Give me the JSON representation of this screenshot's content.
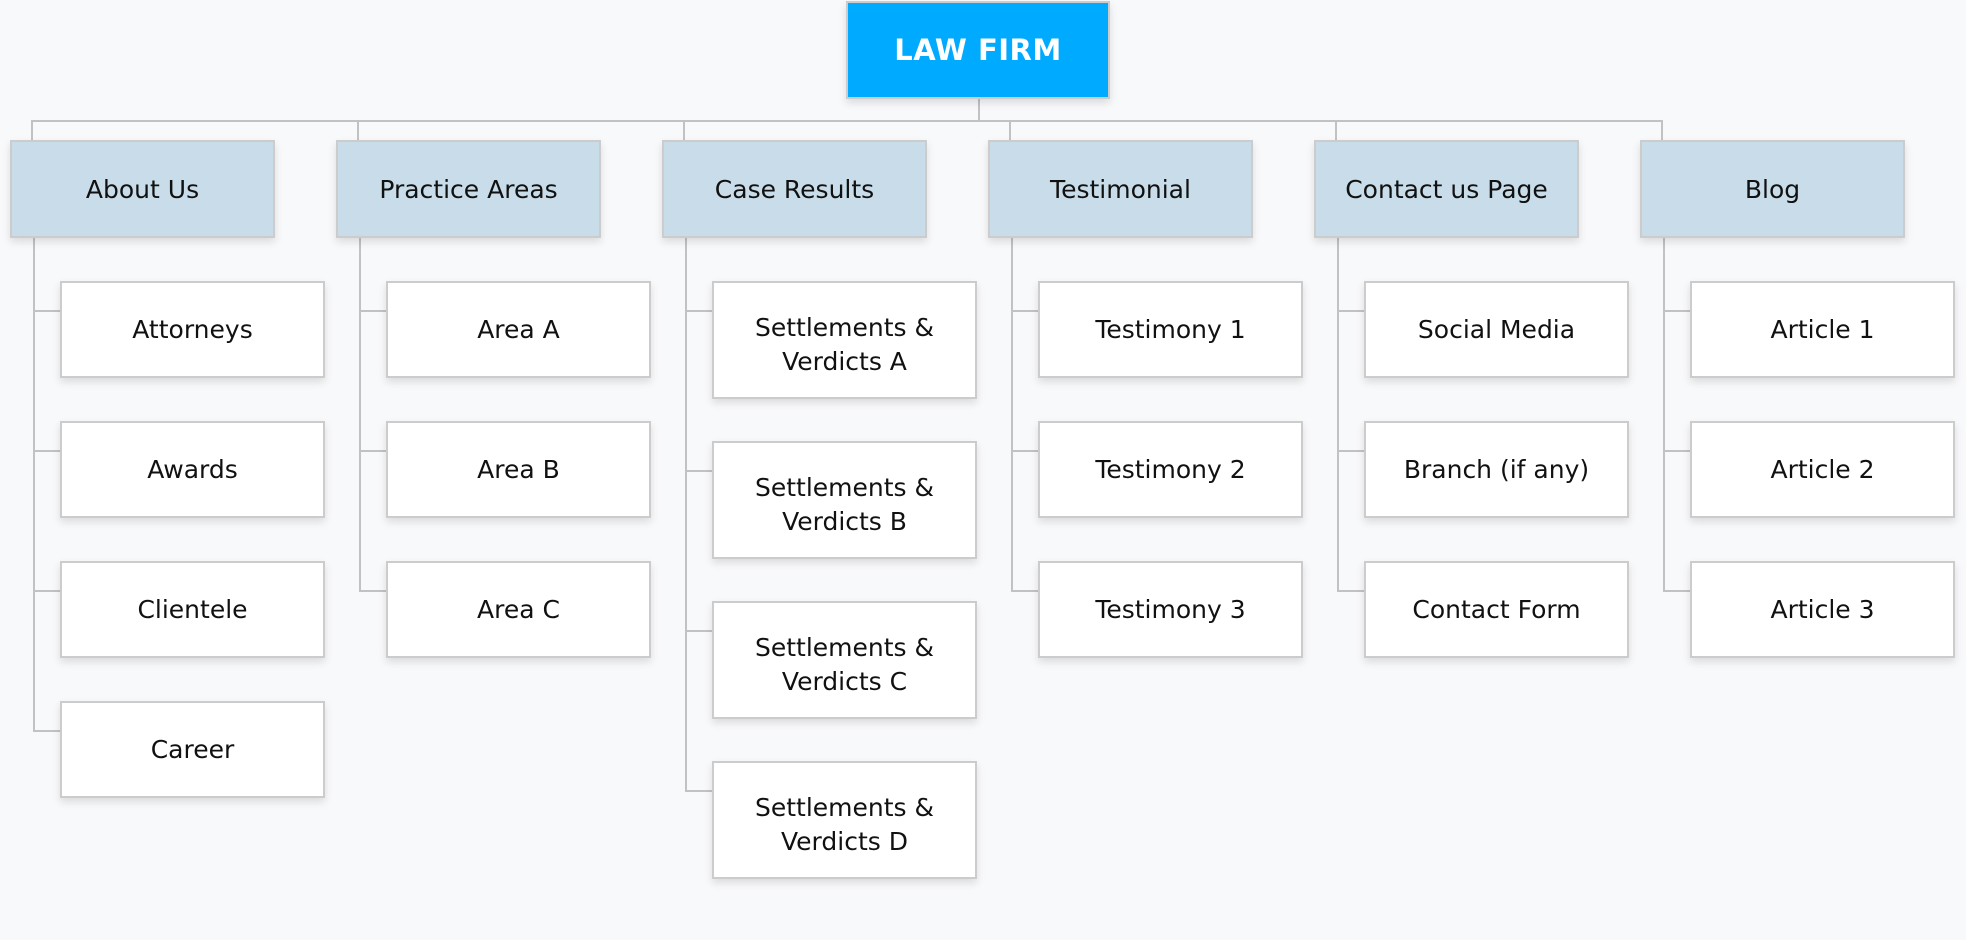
{
  "diagram": {
    "root": {
      "label": "LAW FIRM",
      "color": "#00aaff"
    },
    "branches": [
      {
        "label": "About Us",
        "children": [
          "Attorneys",
          "Awards",
          "Clientele",
          "Career"
        ]
      },
      {
        "label": "Practice Areas",
        "children": [
          "Area A",
          "Area B",
          "Area C"
        ]
      },
      {
        "label": "Case Results",
        "children": [
          "Settlements & Verdicts A",
          "Settlements & Verdicts B",
          "Settlements & Verdicts C",
          "Settlements & Verdicts D"
        ],
        "clipped": true
      },
      {
        "label": "Testimonial",
        "children": [
          "Testimony 1",
          "Testimony 2",
          "Testimony 3"
        ]
      },
      {
        "label": "Contact us Page",
        "children": [
          "Social Media",
          "Branch (if any)",
          "Contact Form"
        ]
      },
      {
        "label": "Blog",
        "children": [
          "Article 1",
          "Article 2",
          "Article 3"
        ]
      }
    ],
    "colors": {
      "header_fill": "#c8dde9",
      "child_fill": "#ffffff",
      "connector": "#c2c2c4",
      "background": "#f8f9fb"
    }
  }
}
